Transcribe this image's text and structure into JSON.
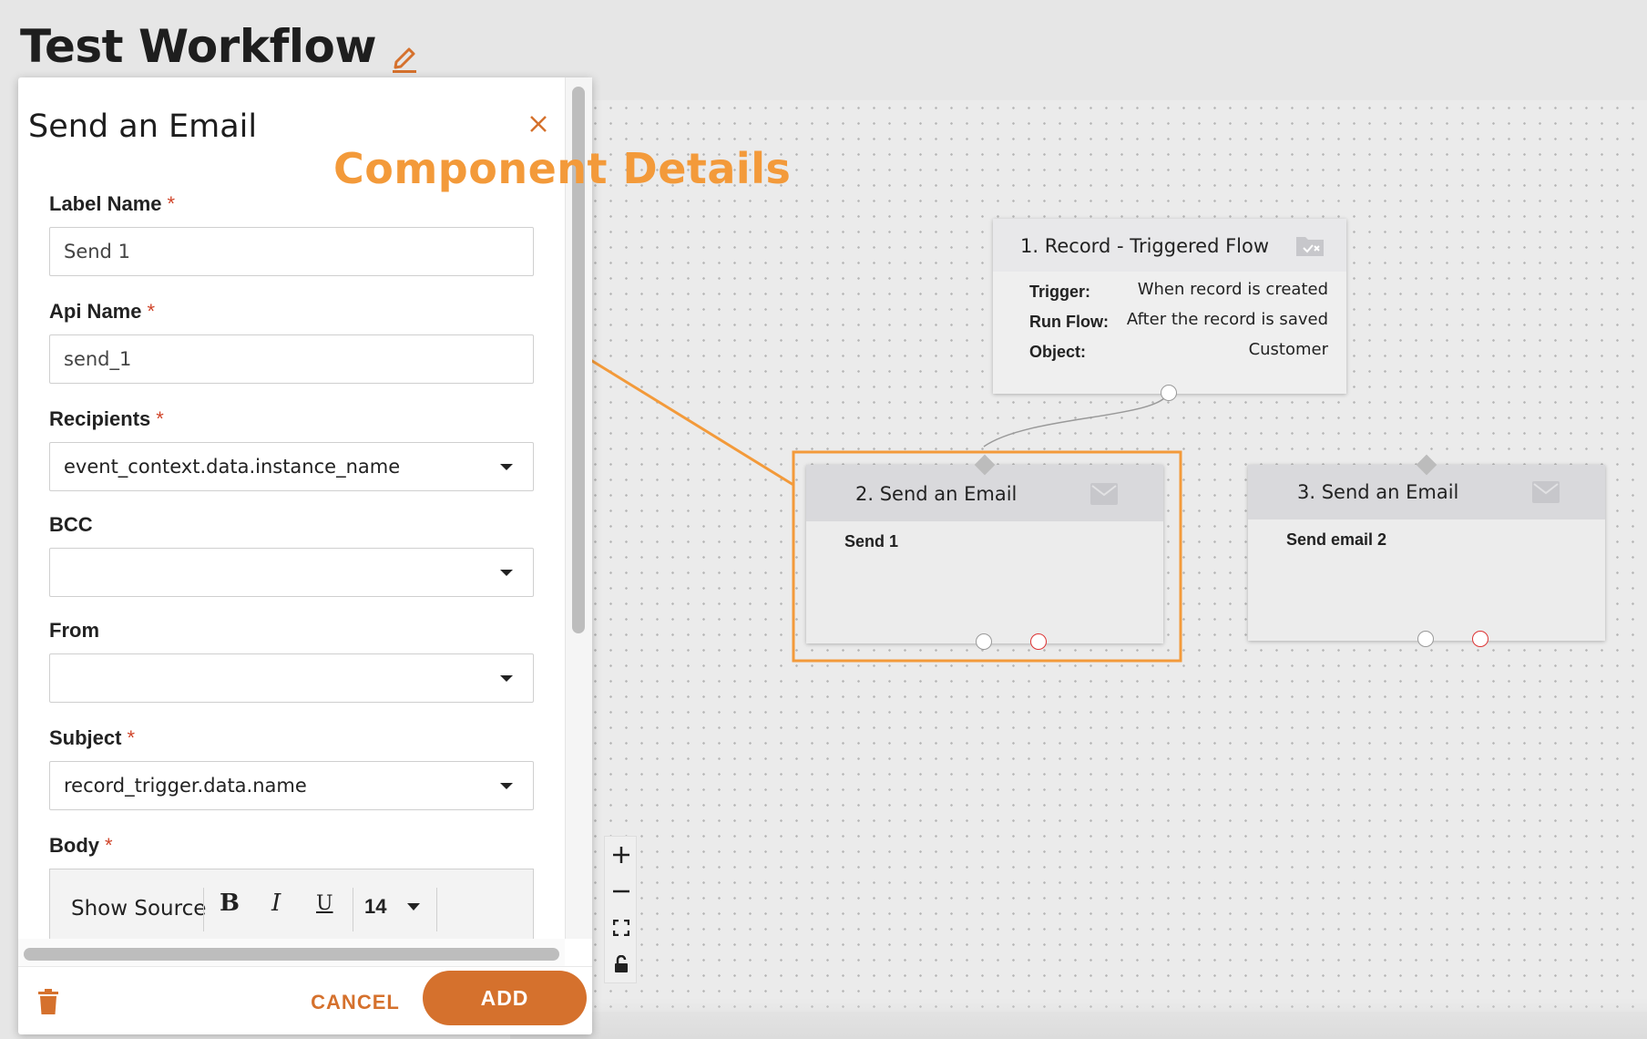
{
  "page": {
    "title": "Test Workflow"
  },
  "panel": {
    "title": "Send an Email",
    "fields": {
      "label_name": {
        "label": "Label Name",
        "required": "*",
        "value": "Send 1"
      },
      "api_name": {
        "label": "Api Name",
        "required": "*",
        "value": "send_1"
      },
      "recipients": {
        "label": "Recipients",
        "required": "*",
        "value": "event_context.data.instance_name"
      },
      "bcc": {
        "label": "BCC",
        "value": ""
      },
      "from": {
        "label": "From",
        "value": ""
      },
      "subject": {
        "label": "Subject",
        "required": "*",
        "value": "record_trigger.data.name"
      },
      "body": {
        "label": "Body",
        "required": "*"
      }
    },
    "editor_toolbar": {
      "show_source": "Show Source",
      "bold": "B",
      "italic": "I",
      "underline": "U",
      "font_size": "14"
    },
    "footer": {
      "cancel_label": "CANCEL",
      "add_label": "ADD"
    }
  },
  "annotation": {
    "label": "Component Details",
    "color": "#f39a3a"
  },
  "nodes": {
    "trigger": {
      "title": "1. Record - Triggered Flow",
      "rows": [
        {
          "label": "Trigger:",
          "value": "When record is created"
        },
        {
          "label": "Run Flow:",
          "value": "After the record is saved"
        },
        {
          "label": "Object:",
          "value": "Customer"
        }
      ]
    },
    "email_1": {
      "title": "2. Send an Email",
      "subtitle": "Send 1"
    },
    "email_2": {
      "title": "3. Send an Email",
      "subtitle": "Send email 2"
    }
  },
  "colors": {
    "accent": "#d5712d",
    "required": "#d0452a"
  },
  "icons": [
    "pencil-icon",
    "close-icon",
    "trash-icon",
    "mail-icon",
    "flow-icon",
    "plus-icon",
    "minus-icon",
    "fit-screen-icon",
    "lock-icon"
  ]
}
